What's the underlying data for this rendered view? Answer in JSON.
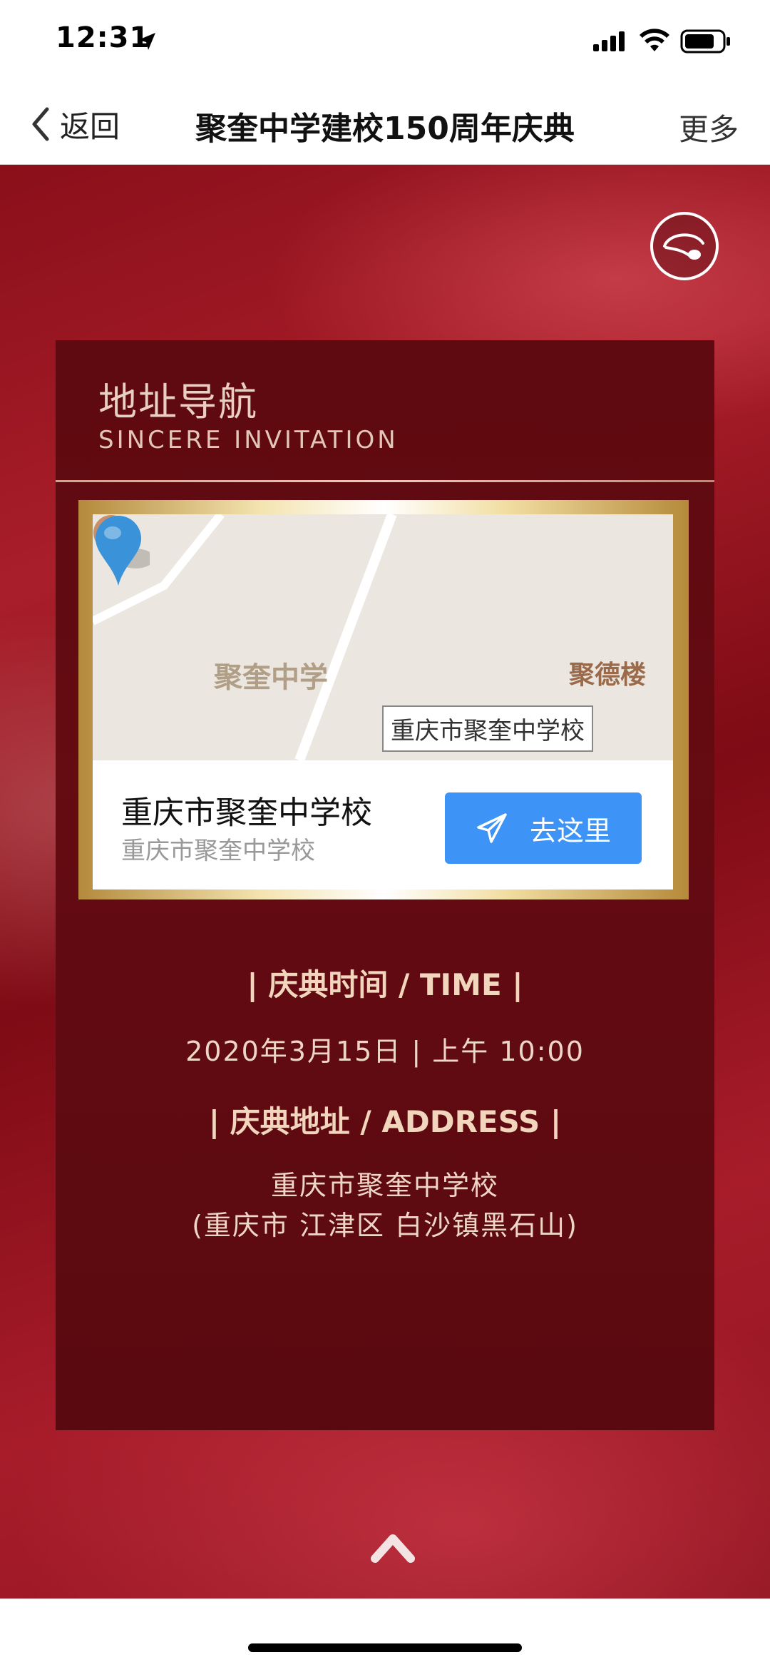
{
  "status_bar": {
    "time": "12:31",
    "icons": [
      "location-arrow-icon",
      "cellular-signal-icon",
      "wifi-icon",
      "battery-icon"
    ]
  },
  "nav": {
    "back_label": "返回",
    "title": "聚奎中学建校150周年庆典",
    "more_label": "更多"
  },
  "card": {
    "title": "地址导航",
    "subtitle": "SINCERE INVITATION"
  },
  "map": {
    "school_label": "聚奎中学",
    "poi_label": "聚德楼",
    "pin_callout": "重庆市聚奎中学校",
    "place_name": "重庆市聚奎中学校",
    "place_address": "重庆市聚奎中学校",
    "go_label": "去这里"
  },
  "info": {
    "time_heading": "| 庆典时间 / TIME |",
    "time_value": "2020年3月15日 | 上午 10:00",
    "address_heading": "| 庆典地址 / ADDRESS |",
    "address_line1": "重庆市聚奎中学校",
    "address_line2": "(重庆市 江津区 白沙镇黑石山)"
  },
  "colors": {
    "background_red": "#a91e2a",
    "card_dark_red": "#5e0a10",
    "accent_blue": "#3d94f6",
    "gold_text": "#f1d5bd"
  }
}
